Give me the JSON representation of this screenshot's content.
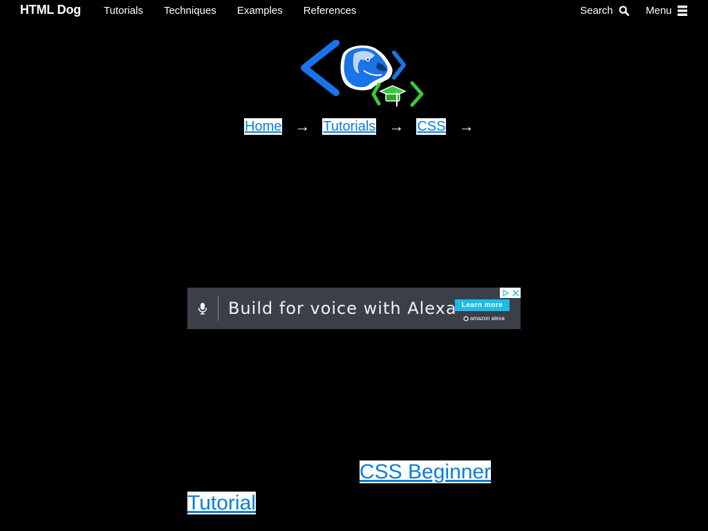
{
  "header": {
    "brand": "HTML Dog",
    "nav": [
      "Tutorials",
      "Techniques",
      "Examples",
      "References"
    ],
    "search_label": "Search",
    "menu_label": "Menu"
  },
  "breadcrumb": {
    "items": [
      "Home",
      "Tutorials",
      "CSS"
    ],
    "separator": "→"
  },
  "ad": {
    "headline": "Build for voice with Alexa",
    "cta": "Learn more",
    "sponsor": "amazon alexa"
  },
  "page": {
    "title_line1": "CSS Beginner",
    "title_line2": "Tutorial"
  },
  "colors": {
    "background": "#000000",
    "link": "#0a7ed8",
    "logo_blue": "#1a73e8",
    "logo_green": "#3cc93c",
    "ad_bg": "#3b3f48",
    "ad_cta": "#1fbbe8"
  }
}
